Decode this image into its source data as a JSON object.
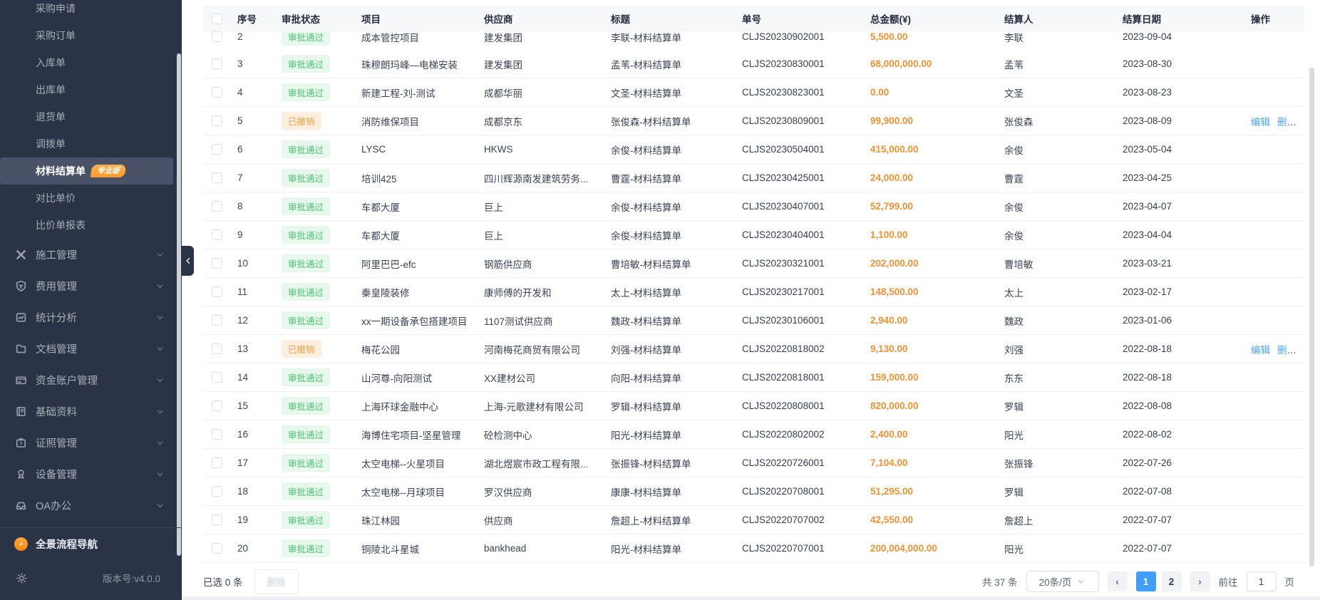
{
  "colors": {
    "sidebar_bg": "#2b3346",
    "accent_blue": "#409eff",
    "link_blue": "#4ba2f8",
    "success_text": "#50c279",
    "success_bg": "#e7f8ec",
    "revoked_text": "#f3a24a",
    "revoked_bg": "#fdeedd",
    "amount_orange": "#ef9234",
    "badge_orange": "#ff9a27"
  },
  "sidebar": {
    "sub_items": [
      {
        "label": "采购申请"
      },
      {
        "label": "采购订单"
      },
      {
        "label": "入库单"
      },
      {
        "label": "出库单"
      },
      {
        "label": "退货单"
      },
      {
        "label": "调拨单"
      },
      {
        "label": "材料结算单",
        "active": true,
        "badge": "专业版"
      },
      {
        "label": "对比单价"
      },
      {
        "label": "比价单报表"
      }
    ],
    "sections": [
      {
        "label": "施工管理",
        "icon": "tools-icon"
      },
      {
        "label": "费用管理",
        "icon": "shield-icon"
      },
      {
        "label": "统计分析",
        "icon": "chart-icon"
      },
      {
        "label": "文档管理",
        "icon": "folder-icon"
      },
      {
        "label": "资金账户管理",
        "icon": "bank-card-icon"
      },
      {
        "label": "基础资料",
        "icon": "notebook-icon"
      },
      {
        "label": "证照管理",
        "icon": "license-icon"
      },
      {
        "label": "设备管理",
        "icon": "device-icon"
      },
      {
        "label": "OA办公",
        "icon": "inbox-icon"
      }
    ],
    "panorama_label": "全景流程导航",
    "version_label": "版本号:v4.0.0"
  },
  "table": {
    "columns": [
      "",
      "序号",
      "审批状态",
      "项目",
      "供应商",
      "标题",
      "单号",
      "总金额(¥)",
      "结算人",
      "结算日期",
      "操作"
    ],
    "status_ok": "审批通过",
    "status_revoked": "已撤销",
    "rows": [
      {
        "no": "2",
        "status": "审批通过",
        "project": "成本管控项目",
        "supplier": "建发集团",
        "title": "李联-材料结算单",
        "order_no": "CLJS20230902001",
        "amount": "5,500.00",
        "settler": "李联",
        "date": "2023-09-04",
        "ops": [],
        "clipped": true
      },
      {
        "no": "3",
        "status": "审批通过",
        "project": "珠穆朗玛峰—电梯安装",
        "supplier": "建发集团",
        "title": "孟苇-材料结算单",
        "order_no": "CLJS20230830001",
        "amount": "68,000,000.00",
        "settler": "孟苇",
        "date": "2023-08-30",
        "ops": []
      },
      {
        "no": "4",
        "status": "审批通过",
        "project": "新建工程-刘-测试",
        "supplier": "成都华丽",
        "title": "文圣-材料结算单",
        "order_no": "CLJS20230823001",
        "amount": "0.00",
        "settler": "文圣",
        "date": "2023-08-23",
        "ops": []
      },
      {
        "no": "5",
        "status": "已撤销",
        "project": "消防维保项目",
        "supplier": "成都京东",
        "title": "张俊森-材料结算单",
        "order_no": "CLJS20230809001",
        "amount": "99,900.00",
        "settler": "张俊森",
        "date": "2023-08-09",
        "ops": [
          "编辑",
          "删除"
        ]
      },
      {
        "no": "6",
        "status": "审批通过",
        "project": "LYSC",
        "supplier": "HKWS",
        "title": "余俊-材料结算单",
        "order_no": "CLJS20230504001",
        "amount": "415,000.00",
        "settler": "余俊",
        "date": "2023-05-04",
        "ops": []
      },
      {
        "no": "7",
        "status": "审批通过",
        "project": "培训425",
        "supplier": "四川辉源南发建筑劳务...",
        "title": "曹霆-材料结算单",
        "order_no": "CLJS20230425001",
        "amount": "24,000.00",
        "settler": "曹霆",
        "date": "2023-04-25",
        "ops": []
      },
      {
        "no": "8",
        "status": "审批通过",
        "project": "车都大厦",
        "supplier": "巨上",
        "title": "余俊-材料结算单",
        "order_no": "CLJS20230407001",
        "amount": "52,799.00",
        "settler": "余俊",
        "date": "2023-04-07",
        "ops": []
      },
      {
        "no": "9",
        "status": "审批通过",
        "project": "车都大厦",
        "supplier": "巨上",
        "title": "余俊-材料结算单",
        "order_no": "CLJS20230404001",
        "amount": "1,100.00",
        "settler": "余俊",
        "date": "2023-04-04",
        "ops": []
      },
      {
        "no": "10",
        "status": "审批通过",
        "project": "阿里巴巴-efc",
        "supplier": "钢筋供应商",
        "title": "曹培敏-材料结算单",
        "order_no": "CLJS20230321001",
        "amount": "202,000.00",
        "settler": "曹培敏",
        "date": "2023-03-21",
        "ops": []
      },
      {
        "no": "11",
        "status": "审批通过",
        "project": "秦皇陵装修",
        "supplier": "康师傅的开发和",
        "title": "太上-材料结算单",
        "order_no": "CLJS20230217001",
        "amount": "148,500.00",
        "settler": "太上",
        "date": "2023-02-17",
        "ops": []
      },
      {
        "no": "12",
        "status": "审批通过",
        "project": "xx一期设备承包搭建项目",
        "supplier": "1107测试供应商",
        "title": "魏政-材料结算单",
        "order_no": "CLJS20230106001",
        "amount": "2,940.00",
        "settler": "魏政",
        "date": "2023-01-06",
        "ops": []
      },
      {
        "no": "13",
        "status": "已撤销",
        "project": "梅花公园",
        "supplier": "河南梅花商贸有限公司",
        "title": "刘强-材料结算单",
        "order_no": "CLJS20220818002",
        "amount": "9,130.00",
        "settler": "刘强",
        "date": "2022-08-18",
        "ops": [
          "编辑",
          "删除"
        ]
      },
      {
        "no": "14",
        "status": "审批通过",
        "project": "山河尊-向阳测试",
        "supplier": "XX建材公司",
        "title": "向阳-材料结算单",
        "order_no": "CLJS20220818001",
        "amount": "159,000.00",
        "settler": "东东",
        "date": "2022-08-18",
        "ops": []
      },
      {
        "no": "15",
        "status": "审批通过",
        "project": "上海环球金融中心",
        "supplier": "上海-元歌建材有限公司",
        "title": "罗辑-材料结算单",
        "order_no": "CLJS20220808001",
        "amount": "820,000.00",
        "settler": "罗辑",
        "date": "2022-08-08",
        "ops": []
      },
      {
        "no": "16",
        "status": "审批通过",
        "project": "海博住宅项目-坚星管理",
        "supplier": "砼检测中心",
        "title": "阳光-材料结算单",
        "order_no": "CLJS20220802002",
        "amount": "2,400.00",
        "settler": "阳光",
        "date": "2022-08-02",
        "ops": []
      },
      {
        "no": "17",
        "status": "审批通过",
        "project": "太空电梯--火星项目",
        "supplier": "湖北煜宸市政工程有限...",
        "title": "张振锋-材料结算单",
        "order_no": "CLJS20220726001",
        "amount": "7,104.00",
        "settler": "张振锋",
        "date": "2022-07-26",
        "ops": []
      },
      {
        "no": "18",
        "status": "审批通过",
        "project": "太空电梯--月球项目",
        "supplier": "罗汉供应商",
        "title": "康康-材料结算单",
        "order_no": "CLJS20220708001",
        "amount": "51,295.00",
        "settler": "罗辑",
        "date": "2022-07-08",
        "ops": []
      },
      {
        "no": "19",
        "status": "审批通过",
        "project": "珠江林园",
        "supplier": "供应商",
        "title": "詹超上-材料结算单",
        "order_no": "CLJS20220707002",
        "amount": "42,550.00",
        "settler": "詹超上",
        "date": "2022-07-07",
        "ops": []
      },
      {
        "no": "20",
        "status": "审批通过",
        "project": "铜陵北斗星城",
        "supplier": "bankhead",
        "title": "阳光-材料结算单",
        "order_no": "CLJS20220707001",
        "amount": "200,004,000.00",
        "settler": "阳光",
        "date": "2022-07-07",
        "ops": []
      }
    ]
  },
  "footer": {
    "selected_label": "已选 0 条",
    "delete_label": "删除"
  },
  "pagination": {
    "total_label": "共 37 条",
    "page_size_label": "20条/页",
    "prev_icon": "‹",
    "next_icon": "›",
    "pages": [
      "1",
      "2"
    ],
    "active_page": "1",
    "goto_label": "前往",
    "goto_value": "1",
    "page_unit_label": "页"
  }
}
